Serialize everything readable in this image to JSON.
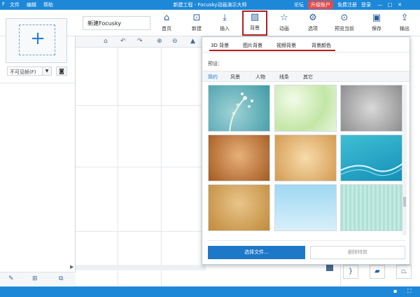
{
  "app": {
    "window_title": "新建工程 - Focusky动画演示大师",
    "menu": [
      "文件",
      "编辑",
      "帮助"
    ],
    "titlebar_links": [
      "论坛",
      "升级账户",
      "免费注册",
      "登录"
    ],
    "window_controls": [
      "—",
      "□",
      "✕"
    ]
  },
  "project": {
    "name": "新建Focusky"
  },
  "toolbar": {
    "items": [
      {
        "label": "首页",
        "icon": "home-icon"
      },
      {
        "label": "新建",
        "icon": "new-icon"
      },
      {
        "label": "插入",
        "icon": "insert-icon"
      },
      {
        "label": "背景",
        "icon": "background-icon",
        "active": true
      },
      {
        "label": "动画",
        "icon": "animation-icon"
      },
      {
        "label": "选项",
        "icon": "gear-icon"
      },
      {
        "label": "预览当前",
        "icon": "preview-icon"
      },
      {
        "label": "保存",
        "icon": "save-icon"
      },
      {
        "label": "输出",
        "icon": "export-icon"
      }
    ]
  },
  "sidebar": {
    "frame_select": "不可见帧(F)"
  },
  "background_panel": {
    "tabs": [
      "3D 背景",
      "图片背景",
      "视频背景",
      "背景颜色"
    ],
    "preset_label": "预设：",
    "categories": [
      "简约",
      "风景",
      "人物",
      "线条",
      "其它"
    ],
    "selected_category": "简约",
    "select_file": "选择文件...",
    "delete": "删除特效"
  },
  "colors": {
    "accent": "#1e88d8",
    "highlight": "#b41f1f",
    "upgrade": "#e54b4b"
  }
}
